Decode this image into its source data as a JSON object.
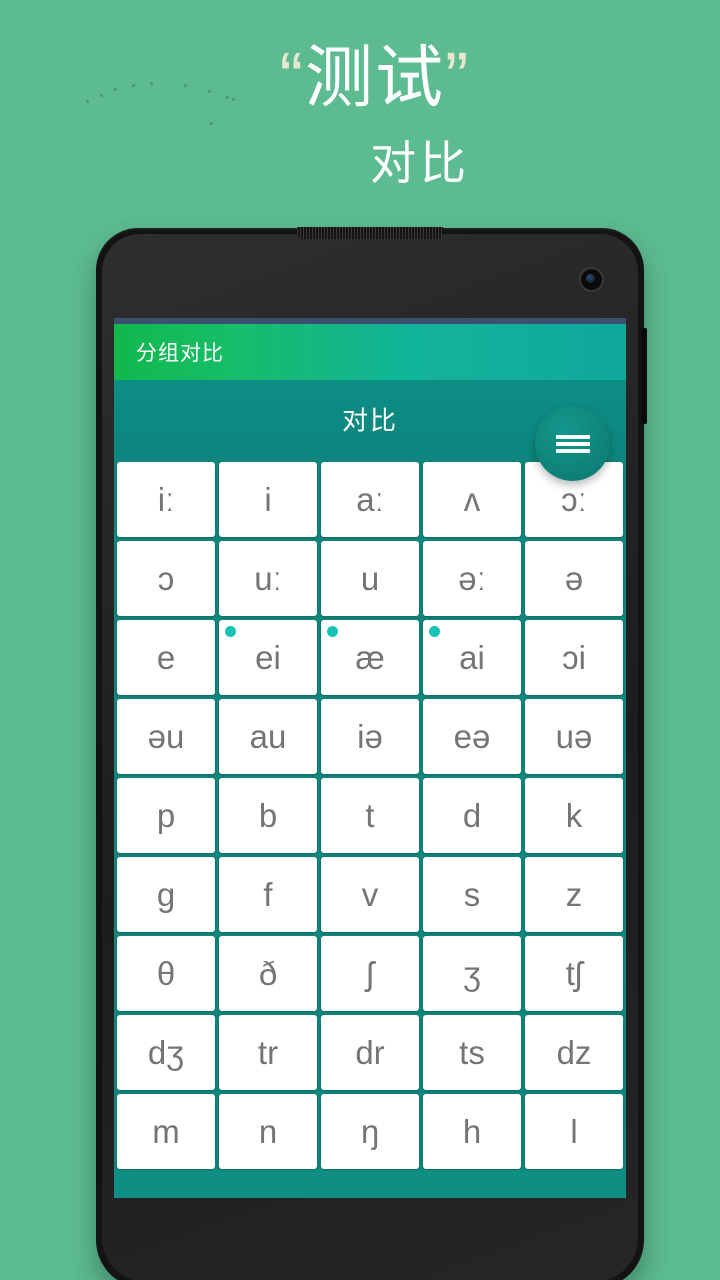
{
  "promo": {
    "quote_open": "“",
    "headline": "测试",
    "quote_close": "”",
    "subline": "对比"
  },
  "colors": {
    "page_background": "#5CBB91",
    "grid_background": "#12857C",
    "appbar_start": "#12B74C",
    "appbar_end": "#0FA89C",
    "subbar": "#0D8E85",
    "fab": "#0C7E76",
    "badge_dot": "#16C3B4",
    "cell_text": "#757575",
    "statusbar": "#3B5070",
    "quote_mark": "#E6E7CE"
  },
  "app": {
    "statusbar": {},
    "appbar": {
      "title": "分组对比",
      "menu_icon": "hamburger-menu-icon"
    },
    "subbar": {
      "title": "对比"
    },
    "grid": {
      "columns": 5,
      "rows": [
        [
          {
            "symbol": "iː",
            "badge": false
          },
          {
            "symbol": "i",
            "badge": false
          },
          {
            "symbol": "aː",
            "badge": false
          },
          {
            "symbol": "ʌ",
            "badge": false
          },
          {
            "symbol": "ɔː",
            "badge": false
          }
        ],
        [
          {
            "symbol": "ɔ",
            "badge": false
          },
          {
            "symbol": "uː",
            "badge": false
          },
          {
            "symbol": "u",
            "badge": false
          },
          {
            "symbol": "əː",
            "badge": false
          },
          {
            "symbol": "ə",
            "badge": false
          }
        ],
        [
          {
            "symbol": "e",
            "badge": false
          },
          {
            "symbol": "ei",
            "badge": true
          },
          {
            "symbol": "æ",
            "badge": true
          },
          {
            "symbol": "ai",
            "badge": true
          },
          {
            "symbol": "ɔi",
            "badge": false
          }
        ],
        [
          {
            "symbol": "əu",
            "badge": false
          },
          {
            "symbol": "au",
            "badge": false
          },
          {
            "symbol": "iə",
            "badge": false
          },
          {
            "symbol": "eə",
            "badge": false
          },
          {
            "symbol": "uə",
            "badge": false
          }
        ],
        [
          {
            "symbol": "p",
            "badge": false
          },
          {
            "symbol": "b",
            "badge": false
          },
          {
            "symbol": "t",
            "badge": false
          },
          {
            "symbol": "d",
            "badge": false
          },
          {
            "symbol": "k",
            "badge": false
          }
        ],
        [
          {
            "symbol": "g",
            "badge": false
          },
          {
            "symbol": "f",
            "badge": false
          },
          {
            "symbol": "v",
            "badge": false
          },
          {
            "symbol": "s",
            "badge": false
          },
          {
            "symbol": "z",
            "badge": false
          }
        ],
        [
          {
            "symbol": "θ",
            "badge": false
          },
          {
            "symbol": "ð",
            "badge": false
          },
          {
            "symbol": "ʃ",
            "badge": false
          },
          {
            "symbol": "ʒ",
            "badge": false
          },
          {
            "symbol": "tʃ",
            "badge": false
          }
        ],
        [
          {
            "symbol": "dʒ",
            "badge": false
          },
          {
            "symbol": "tr",
            "badge": false
          },
          {
            "symbol": "dr",
            "badge": false
          },
          {
            "symbol": "ts",
            "badge": false
          },
          {
            "symbol": "dz",
            "badge": false
          }
        ],
        [
          {
            "symbol": "m",
            "badge": false
          },
          {
            "symbol": "n",
            "badge": false
          },
          {
            "symbol": "ŋ",
            "badge": false
          },
          {
            "symbol": "h",
            "badge": false
          },
          {
            "symbol": "l",
            "badge": false
          }
        ]
      ]
    }
  }
}
